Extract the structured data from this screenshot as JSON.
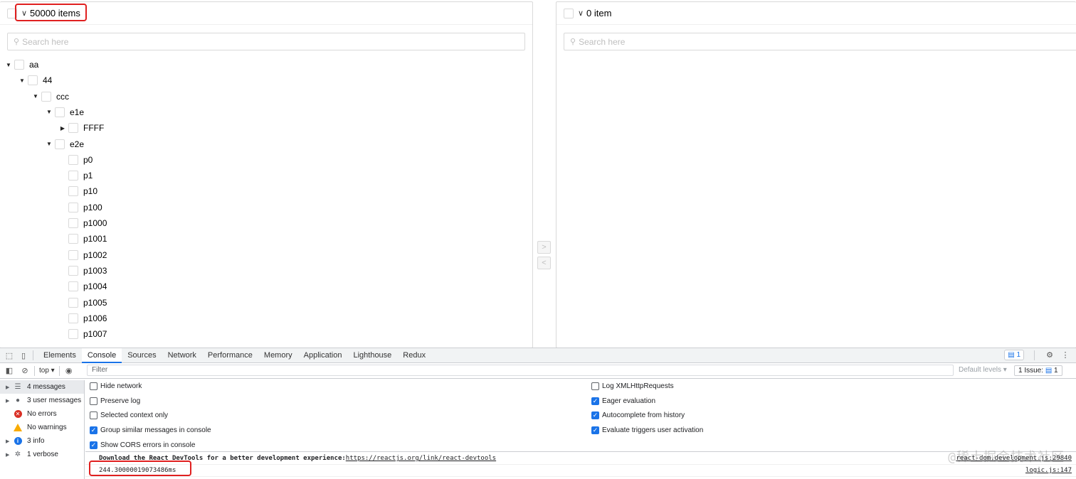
{
  "left_panel": {
    "count_label": "50000 items",
    "search_placeholder": "Search here",
    "tree": [
      {
        "label": "aa",
        "toggle": "▼"
      },
      {
        "label": "44",
        "toggle": "▼"
      },
      {
        "label": "ccc",
        "toggle": "▼"
      },
      {
        "label": "e1e",
        "toggle": "▼"
      },
      {
        "label": "FFFF",
        "toggle": "▶"
      },
      {
        "label": "e2e",
        "toggle": "▼"
      },
      {
        "label": "p0",
        "toggle": ""
      },
      {
        "label": "p1",
        "toggle": ""
      },
      {
        "label": "p10",
        "toggle": ""
      },
      {
        "label": "p100",
        "toggle": ""
      },
      {
        "label": "p1000",
        "toggle": ""
      },
      {
        "label": "p1001",
        "toggle": ""
      },
      {
        "label": "p1002",
        "toggle": ""
      },
      {
        "label": "p1003",
        "toggle": ""
      },
      {
        "label": "p1004",
        "toggle": ""
      },
      {
        "label": "p1005",
        "toggle": ""
      },
      {
        "label": "p1006",
        "toggle": ""
      },
      {
        "label": "p1007",
        "toggle": ""
      }
    ]
  },
  "right_panel": {
    "count_label": "0 item",
    "search_placeholder": "Search here"
  },
  "transfer": {
    "to_right": ">",
    "to_left": "<"
  },
  "devtools": {
    "tabs": [
      "Elements",
      "Console",
      "Sources",
      "Network",
      "Performance",
      "Memory",
      "Application",
      "Lighthouse",
      "Redux"
    ],
    "active_tab": "Console",
    "message_badge": "1",
    "context": "top ▾",
    "filter_placeholder": "Filter",
    "default_levels": "Default levels ▾",
    "issues_label": "1 Issue:",
    "issues_count": "1",
    "sidebar": [
      {
        "label": "4 messages",
        "icon": "list-icon"
      },
      {
        "label": "3 user messages",
        "icon": "user-icon"
      },
      {
        "label": "No errors",
        "icon": "error-icon"
      },
      {
        "label": "No warnings",
        "icon": "warning-icon"
      },
      {
        "label": "3 info",
        "icon": "info-icon"
      },
      {
        "label": "1 verbose",
        "icon": "verbose-icon"
      }
    ],
    "settings_left": [
      {
        "label": "Hide network",
        "checked": false
      },
      {
        "label": "Preserve log",
        "checked": false
      },
      {
        "label": "Selected context only",
        "checked": false
      },
      {
        "label": "Group similar messages in console",
        "checked": true
      },
      {
        "label": "Show CORS errors in console",
        "checked": true
      }
    ],
    "settings_right": [
      {
        "label": "Log XMLHttpRequests",
        "checked": false
      },
      {
        "label": "Eager evaluation",
        "checked": true
      },
      {
        "label": "Autocomplete from history",
        "checked": true
      },
      {
        "label": "Evaluate triggers user activation",
        "checked": true
      }
    ],
    "messages": [
      {
        "text": "Download the React DevTools for a better development experience: ",
        "link": "https://reactjs.org/link/react-devtools",
        "source": "react-dom.development.js:29840"
      },
      {
        "text": "244.30000019073486ms",
        "link": "",
        "source": "logic.js:147"
      }
    ],
    "watermark": "@稀土掘金技术社区"
  }
}
